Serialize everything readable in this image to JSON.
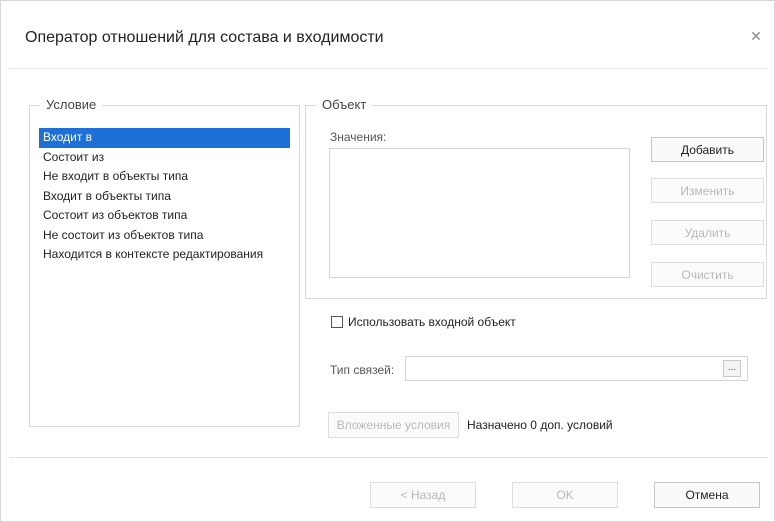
{
  "dialog": {
    "title": "Оператор отношений для состава и входимости",
    "close_icon": "close-icon"
  },
  "condition": {
    "legend": "Условие",
    "items": [
      {
        "label": "Входит в",
        "selected": true
      },
      {
        "label": "Состоит из",
        "selected": false
      },
      {
        "label": "Не входит в объекты типа",
        "selected": false
      },
      {
        "label": "Входит в объекты типа",
        "selected": false
      },
      {
        "label": "Состоит из объектов типа",
        "selected": false
      },
      {
        "label": "Не состоит из объектов типа",
        "selected": false
      },
      {
        "label": "Находится в контексте редактирования",
        "selected": false
      }
    ]
  },
  "object": {
    "legend": "Объект",
    "values_label": "Значения:",
    "add_label": "Добавить",
    "edit_label": "Изменить",
    "delete_label": "Удалить",
    "clear_label": "Очистить"
  },
  "use_input": {
    "label": "Использовать входной объект",
    "checked": false
  },
  "link_type": {
    "label": "Тип связей:",
    "value": "",
    "browse_label": "..."
  },
  "nested": {
    "button_label": "Вложенные условия",
    "status": "Назначено 0 доп. условий"
  },
  "footer": {
    "back_label": "< Назад",
    "ok_label": "OK",
    "cancel_label": "Отмена"
  },
  "colors": {
    "selection": "#1e70d8",
    "disabled_text": "#b8b8b8"
  }
}
